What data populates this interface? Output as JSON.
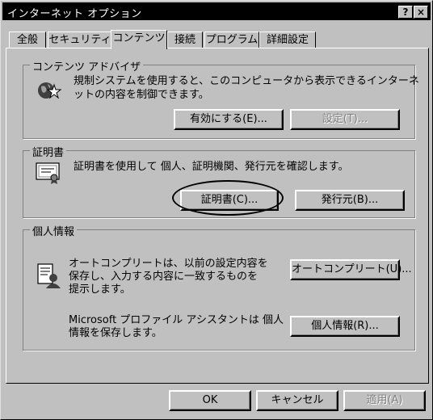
{
  "window": {
    "title": "インターネット オプション"
  },
  "titlebar_buttons": {
    "help": "?",
    "close": "×"
  },
  "tabs": [
    {
      "label": "全般"
    },
    {
      "label": "セキュリティ"
    },
    {
      "label": "コンテンツ"
    },
    {
      "label": "接続"
    },
    {
      "label": "プログラム"
    },
    {
      "label": "詳細設定"
    }
  ],
  "content_advisor": {
    "title": "コンテンツ アドバイザ",
    "desc_line1": "規制システムを使用すると、このコンピュータから表示できるインターネ",
    "desc_line2": "ットの内容を制御できます。",
    "enable_button": "有効にする(E)...",
    "settings_button": "設定(T)..."
  },
  "certificates": {
    "title": "証明書",
    "desc": "証明書を使用して 個人、証明機関、発行元を確認します。",
    "cert_button": "証明書(C)...",
    "publisher_button": "発行元(B)..."
  },
  "personal_info": {
    "title": "個人情報",
    "autocomplete_line1": "オートコンプリートは、以前の設定内容を",
    "autocomplete_line2": "保存し、入力する内容に一致するものを",
    "autocomplete_line3": "提示します。",
    "autocomplete_button": "オートコンプリート(U)...",
    "profile_line1": "Microsoft プロファイル アシスタントは 個人",
    "profile_line2": "情報を保存します。",
    "profile_button": "個人情報(R)..."
  },
  "footer": {
    "ok": "OK",
    "cancel": "キャンセル",
    "apply": "適用(A)"
  }
}
